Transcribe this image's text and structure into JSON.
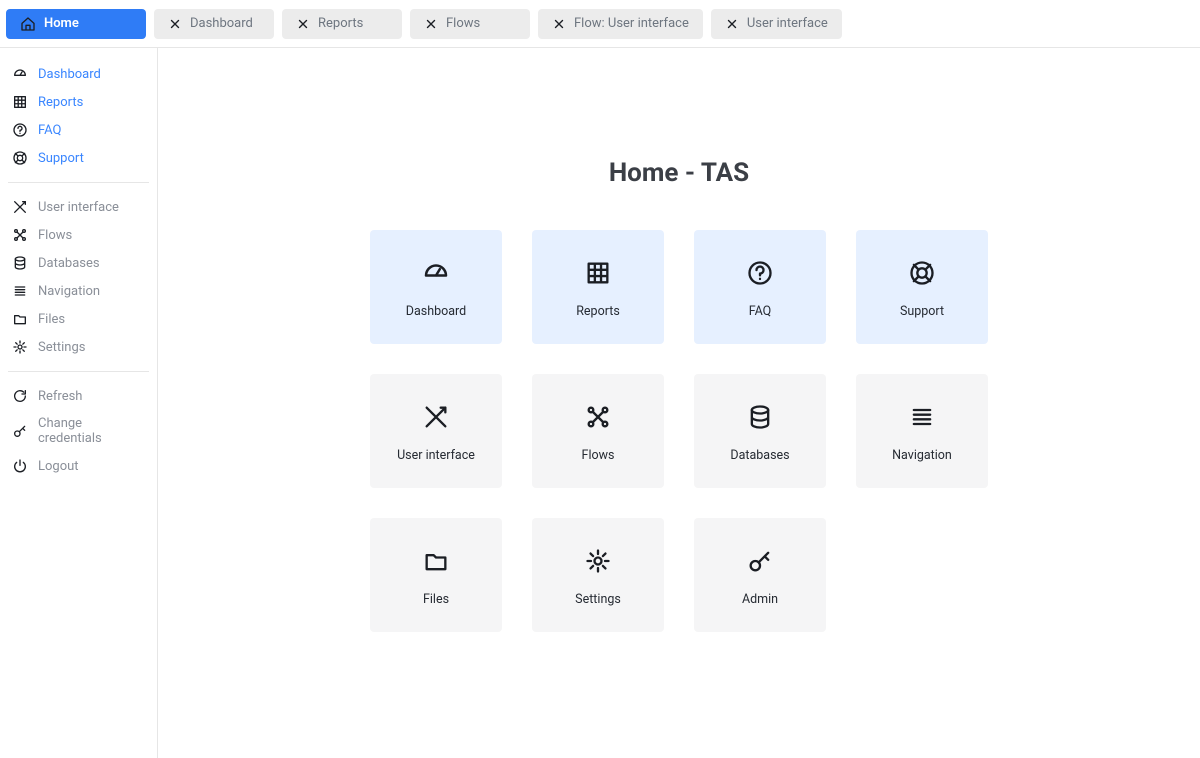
{
  "tabs": [
    {
      "label": "Home",
      "kind": "home",
      "active": true
    },
    {
      "label": "Dashboard",
      "kind": "closable"
    },
    {
      "label": "Reports",
      "kind": "closable"
    },
    {
      "label": "Flows",
      "kind": "closable"
    },
    {
      "label": "Flow: User interface",
      "kind": "closable"
    },
    {
      "label": "User interface",
      "kind": "closable"
    }
  ],
  "sidebar": {
    "group1": [
      {
        "label": "Dashboard",
        "icon": "dashboard",
        "style": "link"
      },
      {
        "label": "Reports",
        "icon": "grid",
        "style": "link"
      },
      {
        "label": "FAQ",
        "icon": "help",
        "style": "link"
      },
      {
        "label": "Support",
        "icon": "lifebuoy",
        "style": "link"
      }
    ],
    "group2": [
      {
        "label": "User interface",
        "icon": "design",
        "style": ""
      },
      {
        "label": "Flows",
        "icon": "flows",
        "style": ""
      },
      {
        "label": "Databases",
        "icon": "database",
        "style": ""
      },
      {
        "label": "Navigation",
        "icon": "list",
        "style": ""
      },
      {
        "label": "Files",
        "icon": "folder",
        "style": ""
      },
      {
        "label": "Settings",
        "icon": "gear",
        "style": ""
      }
    ],
    "group3": [
      {
        "label": "Refresh",
        "icon": "refresh",
        "style": ""
      },
      {
        "label": "Change credentials",
        "icon": "key",
        "style": ""
      },
      {
        "label": "Logout",
        "icon": "power",
        "style": "danger"
      }
    ]
  },
  "page": {
    "title": "Home - TAS"
  },
  "tiles": [
    {
      "label": "Dashboard",
      "icon": "dashboard",
      "tone": "blue"
    },
    {
      "label": "Reports",
      "icon": "grid",
      "tone": "blue"
    },
    {
      "label": "FAQ",
      "icon": "help",
      "tone": "blue"
    },
    {
      "label": "Support",
      "icon": "lifebuoy",
      "tone": "blue"
    },
    {
      "label": "User interface",
      "icon": "design",
      "tone": "gray"
    },
    {
      "label": "Flows",
      "icon": "flows",
      "tone": "gray"
    },
    {
      "label": "Databases",
      "icon": "database",
      "tone": "gray"
    },
    {
      "label": "Navigation",
      "icon": "list",
      "tone": "gray"
    },
    {
      "label": "Files",
      "icon": "folder",
      "tone": "gray"
    },
    {
      "label": "Settings",
      "icon": "gear",
      "tone": "gray"
    },
    {
      "label": "Admin",
      "icon": "key",
      "tone": "gray"
    }
  ]
}
